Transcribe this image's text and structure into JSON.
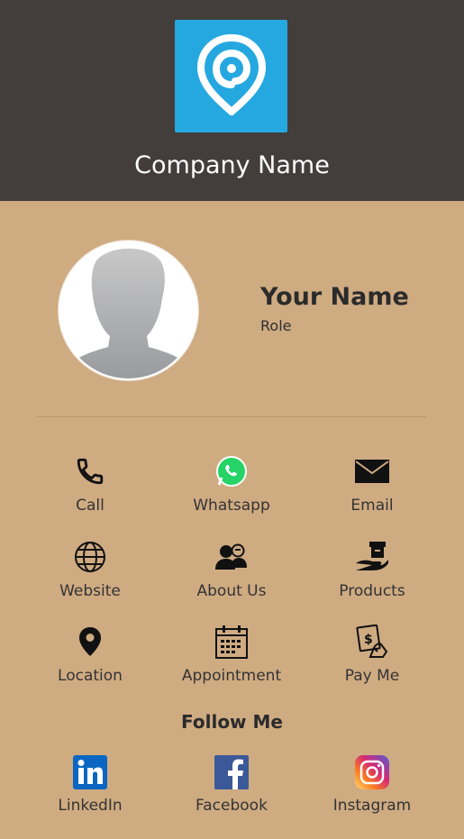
{
  "header": {
    "company_name": "Company Name",
    "logo_icon": "location-pin-logo-icon",
    "background_color": "#433e3c",
    "logo_color": "#25a8e0"
  },
  "profile": {
    "name": "Your Name",
    "role": "Role",
    "avatar_icon": "person-silhouette-icon"
  },
  "actions": [
    {
      "label": "Call",
      "icon": "phone-icon"
    },
    {
      "label": "Whatsapp",
      "icon": "whatsapp-icon"
    },
    {
      "label": "Email",
      "icon": "envelope-icon"
    },
    {
      "label": "Website",
      "icon": "globe-icon"
    },
    {
      "label": "About Us",
      "icon": "people-icon"
    },
    {
      "label": "Products",
      "icon": "box-in-hand-icon"
    },
    {
      "label": "Location",
      "icon": "map-pin-icon"
    },
    {
      "label": "Appointment",
      "icon": "calendar-icon"
    },
    {
      "label": "Pay Me",
      "icon": "money-hand-icon"
    }
  ],
  "follow": {
    "title": "Follow Me",
    "links": [
      {
        "label": "LinkedIn",
        "icon": "linkedin-icon"
      },
      {
        "label": "Facebook",
        "icon": "facebook-icon"
      },
      {
        "label": "Instagram",
        "icon": "instagram-icon"
      }
    ]
  },
  "colors": {
    "page_background": "#cfab82",
    "linkedin": "#0a66c2",
    "facebook": "#3b5998",
    "whatsapp": "#25d366"
  }
}
